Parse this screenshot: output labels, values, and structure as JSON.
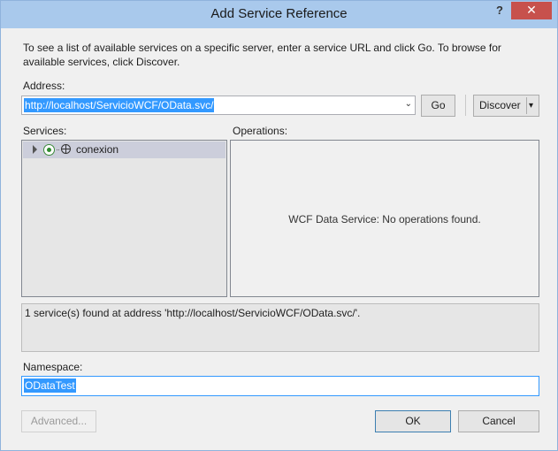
{
  "window": {
    "title": "Add Service Reference",
    "help_glyph": "?",
    "close_glyph": "✕"
  },
  "intro_text": "To see a list of available services on a specific server, enter a service URL and click Go. To browse for available services, click Discover.",
  "address": {
    "label": "Address:",
    "value": "http://localhost/ServicioWCF/OData.svc/",
    "dropdown_glyph": "⌄"
  },
  "buttons": {
    "go": "Go",
    "discover": "Discover",
    "discover_arrow": "▾",
    "advanced": "Advanced...",
    "ok": "OK",
    "cancel": "Cancel"
  },
  "services": {
    "label": "Services:",
    "items": [
      {
        "name": "conexion",
        "selected": true
      }
    ]
  },
  "operations": {
    "label": "Operations:",
    "message": "WCF Data Service: No operations found."
  },
  "status_text": "1 service(s) found at address 'http://localhost/ServicioWCF/OData.svc/'.",
  "namespace": {
    "label": "Namespace:",
    "value": "ODataTest"
  },
  "colors": {
    "titlebar": "#a9c9ec",
    "close_button": "#c7514c",
    "selection": "#3399ff"
  }
}
